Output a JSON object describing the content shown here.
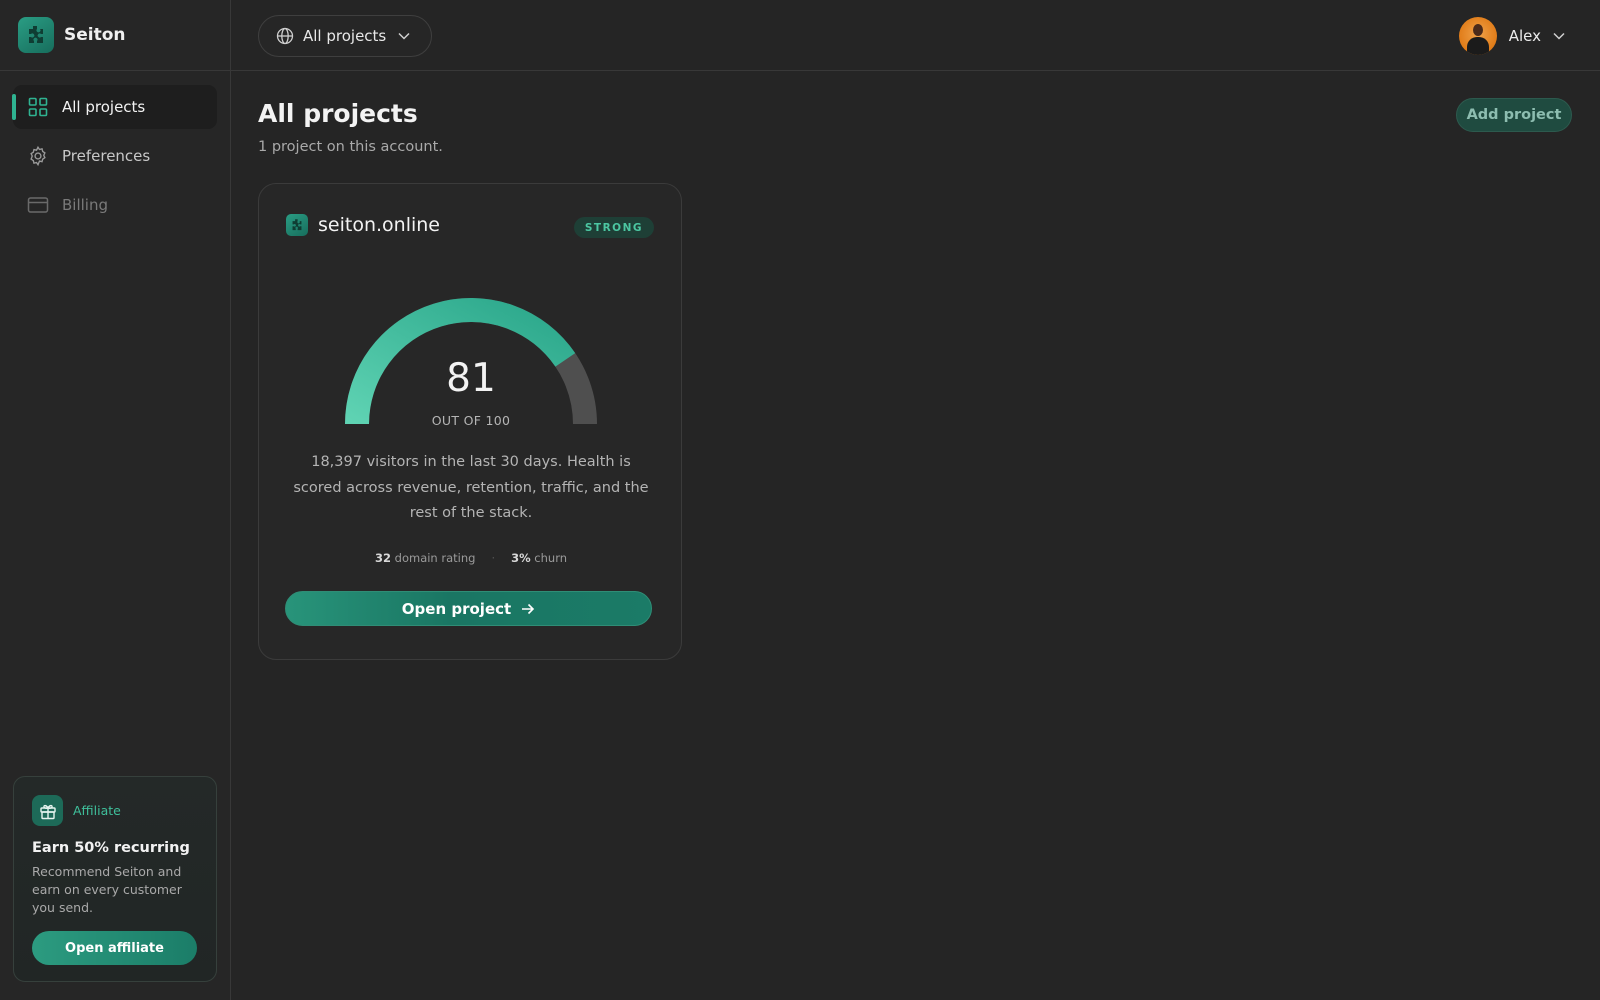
{
  "brand": {
    "name": "Seiton"
  },
  "sidebar": {
    "items": [
      {
        "label": "All projects",
        "icon": "grid-icon",
        "state": "active"
      },
      {
        "label": "Preferences",
        "icon": "gear-icon",
        "state": "normal"
      },
      {
        "label": "Billing",
        "icon": "card-icon",
        "state": "disabled"
      }
    ]
  },
  "affiliate": {
    "tag": "Affiliate",
    "title": "Earn 50% recurring",
    "text": "Recommend Seiton and earn on every customer you send.",
    "button": "Open affiliate",
    "icon": "gift-icon"
  },
  "topbar": {
    "project_selector": "All projects",
    "selector_icon": "globe-icon",
    "user_name": "Alex"
  },
  "page": {
    "title": "All projects",
    "subtitle": "1 project on this account.",
    "add_button": "Add project"
  },
  "project_card": {
    "site": "seiton.online",
    "badge": "STRONG",
    "score": "81",
    "score_value": 81,
    "score_max": 100,
    "score_caption": "OUT OF 100",
    "description": "18,397 visitors in the last 30 days. Health is scored across revenue, retention, traffic, and the rest of the stack.",
    "metric1_value": "32",
    "metric1_label": "domain rating",
    "metric2_value": "3%",
    "metric2_label": "churn",
    "open_button": "Open project"
  },
  "colors": {
    "accent": "#2fb391",
    "gauge_start": "#5fd3b3",
    "gauge_end": "#2aa68a",
    "gauge_track": "#4f4f4f",
    "background": "#252525"
  }
}
